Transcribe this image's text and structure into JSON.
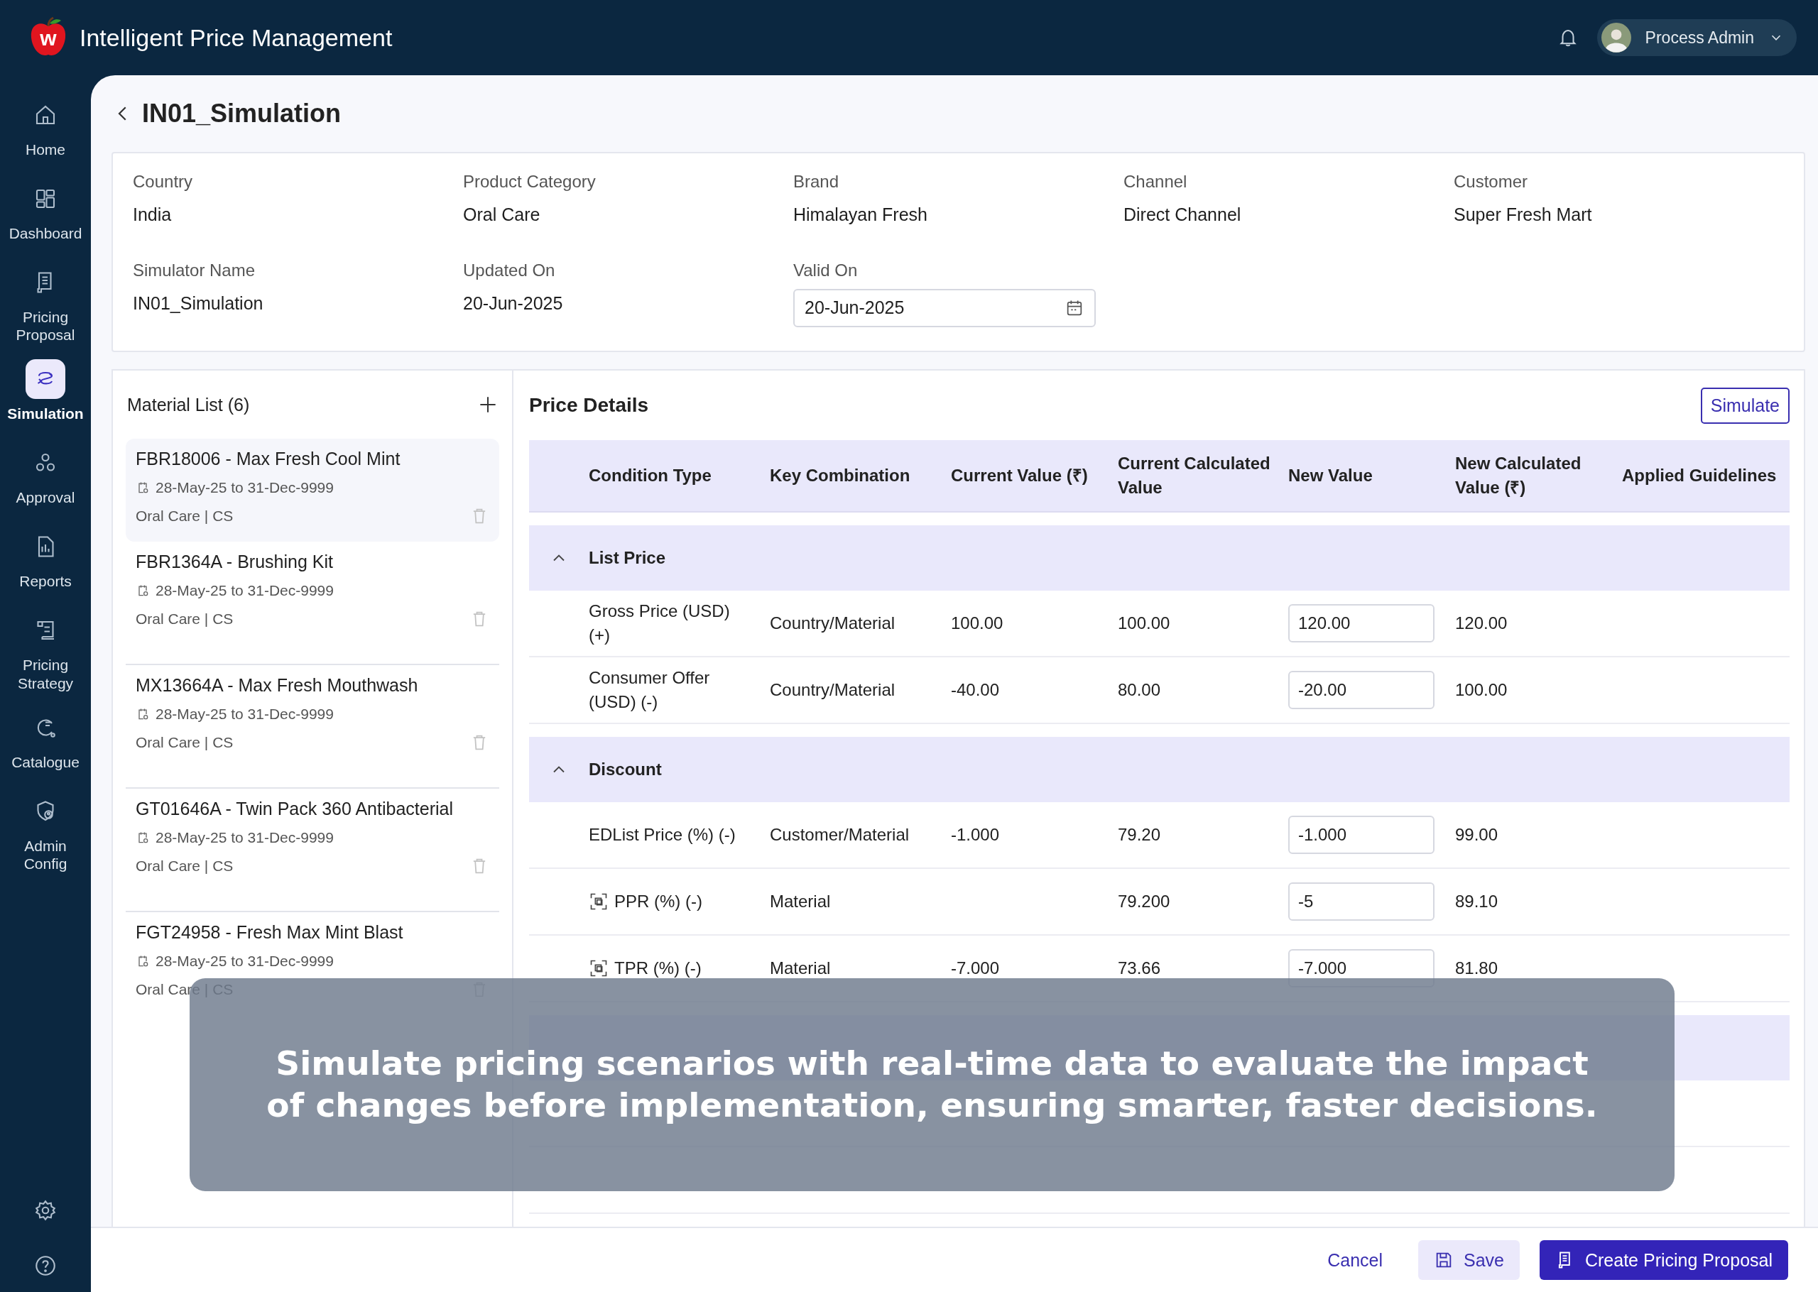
{
  "app": {
    "logo_letter": "w",
    "title": "Intelligent Price Management"
  },
  "user": {
    "name": "Process Admin"
  },
  "nav": [
    {
      "label": "Home",
      "selected": false
    },
    {
      "label": "Dashboard",
      "selected": false
    },
    {
      "label": "Pricing Proposal",
      "selected": false
    },
    {
      "label": "Simulation",
      "selected": true
    },
    {
      "label": "Approval",
      "selected": false
    },
    {
      "label": "Reports",
      "selected": false
    },
    {
      "label": "Pricing Strategy",
      "selected": false
    },
    {
      "label": "Catalogue",
      "selected": false
    },
    {
      "label": "Admin Config",
      "selected": false
    }
  ],
  "page_title": "IN01_Simulation",
  "info": [
    {
      "label": "Country",
      "value": "India",
      "kind": "text"
    },
    {
      "label": "Product Category",
      "value": "Oral Care",
      "kind": "text"
    },
    {
      "label": "Brand",
      "value": "Himalayan Fresh",
      "kind": "text"
    },
    {
      "label": "Channel",
      "value": "Direct Channel",
      "kind": "text"
    },
    {
      "label": "Customer",
      "value": "Super Fresh Mart",
      "kind": "text"
    },
    {
      "label": "Simulator Name",
      "value": "IN01_Simulation",
      "kind": "text"
    },
    {
      "label": "Updated On",
      "value": "20-Jun-2025",
      "kind": "text"
    },
    {
      "label": "Valid On",
      "value": "20-Jun-2025",
      "kind": "date"
    }
  ],
  "materials": {
    "title": "Material List (6)",
    "items": [
      {
        "name": "FBR18006 - Max Fresh Cool Mint",
        "dates": "28-May-25 to 31-Dec-9999",
        "category": "Oral Care | CS",
        "selected": true
      },
      {
        "name": "FBR1364A - Brushing Kit",
        "dates": "28-May-25 to 31-Dec-9999",
        "category": "Oral Care | CS",
        "selected": false
      },
      {
        "name": "MX13664A - Max Fresh Mouthwash",
        "dates": "28-May-25 to 31-Dec-9999",
        "category": "Oral Care | CS",
        "selected": false
      },
      {
        "name": "GT01646A - Twin Pack 360 Antibacterial",
        "dates": "28-May-25 to 31-Dec-9999",
        "category": "Oral Care | CS",
        "selected": false
      },
      {
        "name": "FGT24958 - Fresh Max Mint Blast",
        "dates": "28-May-25 to 31-Dec-9999",
        "category": "Oral Care | CS",
        "selected": false
      }
    ]
  },
  "price_details": {
    "title": "Price Details",
    "simulate_label": "Simulate",
    "columns": [
      "Condition Type",
      "Key Combination",
      "Current Value (₹)",
      "Current Calculated Value",
      "New Value",
      "New Calculated Value (₹)",
      "Applied Guidelines"
    ],
    "sections": [
      {
        "title": "List Price",
        "expanded": true,
        "rows": [
          {
            "kind": "input",
            "condition": "Gross Price (USD) (+)",
            "key": "Country/Material",
            "current": "100.00",
            "current_calc": "100.00",
            "new_value": "120.00",
            "new_calc": "120.00"
          },
          {
            "kind": "input",
            "condition": "Consumer Offer (USD) (-)",
            "key": "Country/Material",
            "current": "-40.00",
            "current_calc": "80.00",
            "new_value": "-20.00",
            "new_calc": "100.00"
          }
        ]
      },
      {
        "title": "Discount",
        "expanded": true,
        "rows": [
          {
            "kind": "input",
            "condition": "EDList Price (%) (-)",
            "key": "Customer/Material",
            "current": "-1.000",
            "current_calc": "79.20",
            "new_value": "-1.000",
            "new_calc": "99.00"
          },
          {
            "kind": "input_icon",
            "condition": "PPR (%) (-)",
            "key": "Material",
            "current_calc": "79.200",
            "new_value": "-5",
            "new_calc": "89.10"
          },
          {
            "kind": "input_icon",
            "condition": "TPR (%) (-)",
            "key": "Material",
            "current": "-7.000",
            "current_calc": "73.66",
            "new_value": "-7.000",
            "new_calc": "81.80"
          }
        ]
      }
    ]
  },
  "actions": {
    "cancel": "Cancel",
    "save": "Save",
    "create": "Create Pricing Proposal"
  },
  "caption": "Simulate pricing scenarios with real-time data to evaluate the impact of changes before implementation, ensuring smarter, faster decisions."
}
